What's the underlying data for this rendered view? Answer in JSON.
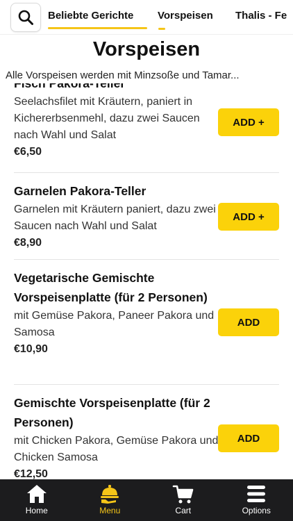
{
  "tabs": [
    {
      "label": "Beliebte Gerichte"
    },
    {
      "label": "Vorspeisen"
    },
    {
      "label": "Thalis - Fe"
    }
  ],
  "section": {
    "title": "Vorspeisen",
    "description": "Alle Vorspeisen werden mit Minzsoße und Tamar..."
  },
  "items": [
    {
      "name": "Fisch Pakora-Teller",
      "description": "Seelachsfilet mit Kräutern, paniert in Kichererbsenmehl, dazu zwei Saucen nach Wahl und Salat",
      "price": "€6,50",
      "button": "ADD +"
    },
    {
      "name": "Garnelen Pakora-Teller",
      "description": "Garnelen mit Kräutern paniert, dazu zwei Saucen nach Wahl und Salat",
      "price": "€8,90",
      "button": "ADD +"
    },
    {
      "name": "Vegetarische Gemischte Vorspeisenplatte (für 2 Personen)",
      "description": "mit Gemüse Pakora, Paneer Pakora und Samosa",
      "price": "€10,90",
      "button": "ADD"
    },
    {
      "name": "Gemischte Vorspeisenplatte (für 2 Personen)",
      "description": "mit Chicken Pakora, Gemüse Pakora und Chicken Samosa",
      "price": "€12,50",
      "button": "ADD"
    }
  ],
  "nav": [
    {
      "label": "Home",
      "icon": "home-icon"
    },
    {
      "label": "Menu",
      "icon": "menu-icon"
    },
    {
      "label": "Cart",
      "icon": "cart-icon"
    },
    {
      "label": "Options",
      "icon": "options-icon"
    }
  ],
  "colors": {
    "accent": "#fbd20a",
    "nav_background": "#1c1c1e",
    "active_nav": "#f5c518"
  }
}
